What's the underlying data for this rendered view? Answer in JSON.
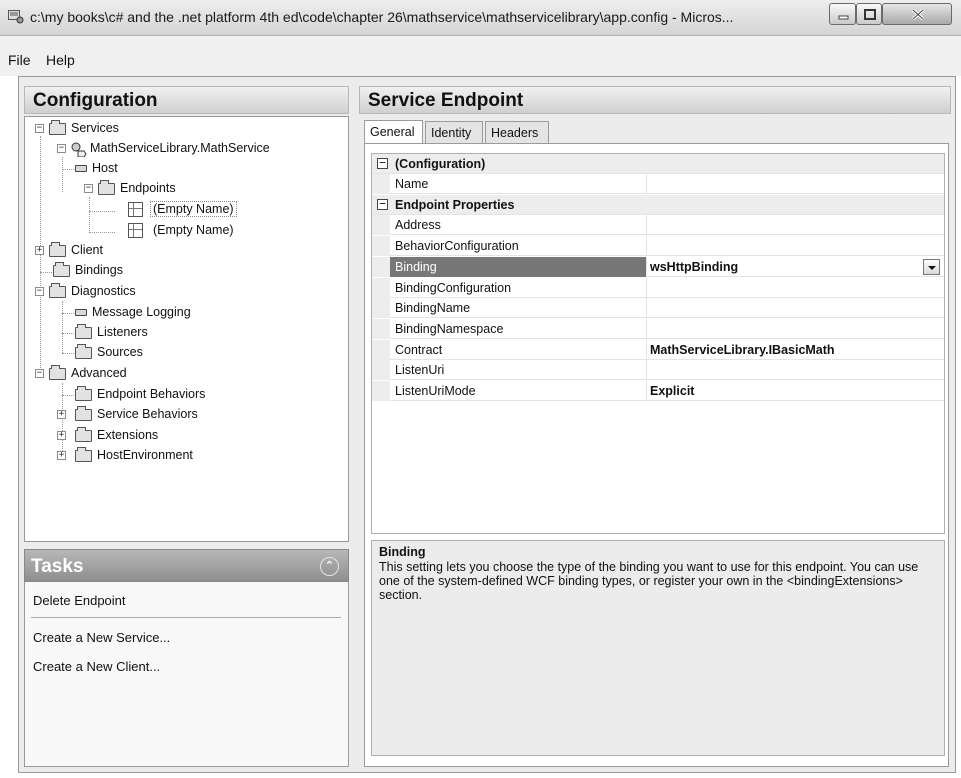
{
  "window": {
    "title": "c:\\my books\\c# and the .net platform 4th ed\\code\\chapter 26\\mathservice\\mathservicelibrary\\app.config - Micros..."
  },
  "menu": {
    "file": "File",
    "help": "Help"
  },
  "configuration": {
    "header": "Configuration",
    "tree": {
      "services": "Services",
      "math_service": "MathServiceLibrary.MathService",
      "host": "Host",
      "endpoints": "Endpoints",
      "endpoint_1": "(Empty Name)",
      "endpoint_2": "(Empty Name)",
      "client": "Client",
      "bindings": "Bindings",
      "diagnostics": "Diagnostics",
      "message_logging": "Message Logging",
      "listeners": "Listeners",
      "sources": "Sources",
      "advanced": "Advanced",
      "endpoint_behaviors": "Endpoint Behaviors",
      "service_behaviors": "Service Behaviors",
      "extensions": "Extensions",
      "host_environment": "HostEnvironment"
    }
  },
  "tasks": {
    "header": "Tasks",
    "delete_endpoint": "Delete Endpoint",
    "create_service": "Create a New Service...",
    "create_client": "Create a New Client..."
  },
  "endpoint": {
    "header": "Service Endpoint",
    "tabs": {
      "general": "General",
      "identity": "Identity",
      "headers": "Headers"
    },
    "categories": {
      "configuration": "(Configuration)",
      "endpoint_properties": "Endpoint Properties"
    },
    "properties": {
      "name": {
        "label": "Name",
        "value": ""
      },
      "address": {
        "label": "Address",
        "value": ""
      },
      "behavior_configuration": {
        "label": "BehaviorConfiguration",
        "value": ""
      },
      "binding": {
        "label": "Binding",
        "value": "wsHttpBinding"
      },
      "binding_configuration": {
        "label": "BindingConfiguration",
        "value": ""
      },
      "binding_name": {
        "label": "BindingName",
        "value": ""
      },
      "binding_namespace": {
        "label": "BindingNamespace",
        "value": ""
      },
      "contract": {
        "label": "Contract",
        "value": "MathServiceLibrary.IBasicMath"
      },
      "listen_uri": {
        "label": "ListenUri",
        "value": ""
      },
      "listen_uri_mode": {
        "label": "ListenUriMode",
        "value": "Explicit"
      }
    },
    "description": {
      "title": "Binding",
      "text": "This setting lets you choose the type of the binding you want to use for this endpoint. You can use one of the system-defined WCF binding types, or register your own in the <bindingExtensions> section."
    }
  }
}
